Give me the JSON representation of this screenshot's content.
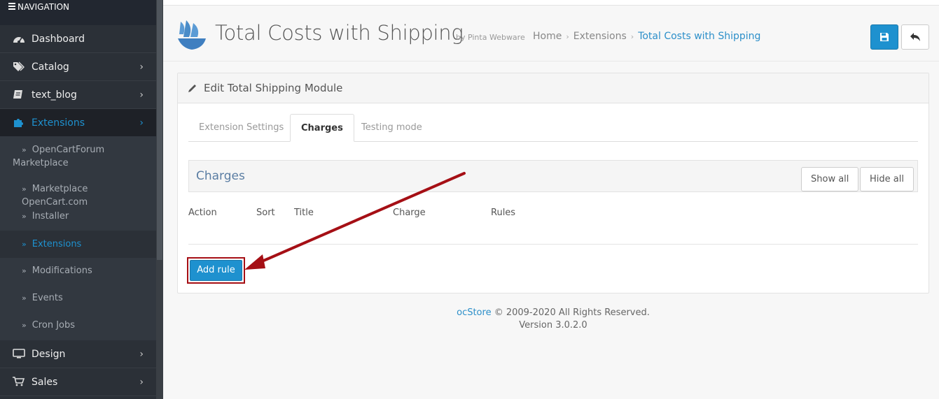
{
  "sidebar": {
    "header": "NAVIGATION",
    "items": [
      {
        "label": "Dashboard",
        "icon": "dashboard-icon"
      },
      {
        "label": "Catalog",
        "icon": "tags-icon"
      },
      {
        "label": "text_blog",
        "icon": "book-icon"
      },
      {
        "label": "Extensions",
        "icon": "puzzle-icon"
      },
      {
        "label": "Design",
        "icon": "monitor-icon"
      },
      {
        "label": "Sales",
        "icon": "cart-icon"
      }
    ],
    "subitems": [
      {
        "label": "OpenCartForum Marketplace"
      },
      {
        "label": "Marketplace OpenCart.com"
      },
      {
        "label": "Installer"
      },
      {
        "label": "Extensions"
      },
      {
        "label": "Modifications"
      },
      {
        "label": "Events"
      },
      {
        "label": "Cron Jobs"
      }
    ]
  },
  "header": {
    "title": "Total Costs with Shipping",
    "byline": "by Pinta Webware",
    "breadcrumb": [
      "Home",
      "Extensions",
      "Total Costs with Shipping"
    ]
  },
  "panel": {
    "title": "Edit Total Shipping Module",
    "tabs": [
      "Extension Settings",
      "Charges",
      "Testing mode"
    ],
    "active_tab": "Charges",
    "charges_title": "Charges",
    "show_all": "Show all",
    "hide_all": "Hide all",
    "columns": [
      "Action",
      "Sort",
      "Title",
      "Charge",
      "Rules"
    ],
    "add_rule": "Add rule"
  },
  "footer": {
    "brand": "ocStore",
    "rights": "© 2009-2020 All Rights Reserved.",
    "version": "Version 3.0.2.0"
  },
  "colors": {
    "primary": "#1e91cf",
    "sidebar_bg": "#2b3037",
    "annotation": "#a50f15"
  }
}
